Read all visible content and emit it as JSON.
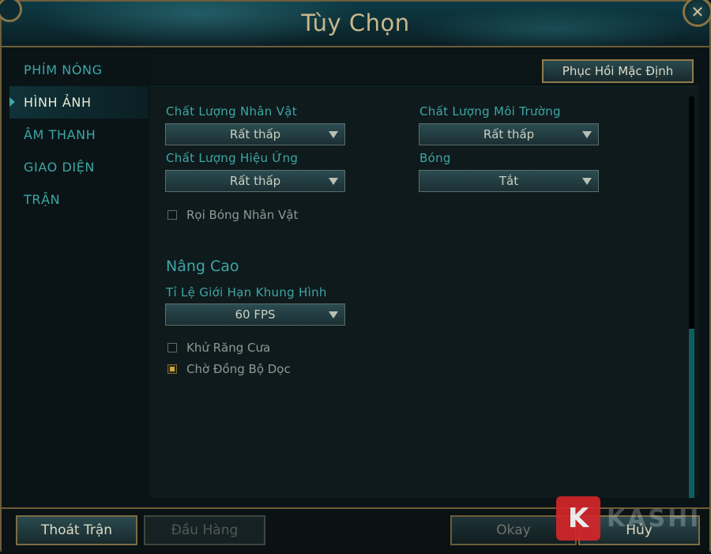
{
  "window": {
    "title": "Tùy Chọn",
    "close_icon": "close-icon"
  },
  "sidebar": {
    "items": [
      {
        "label": "PHÍM NÓNG",
        "active": false
      },
      {
        "label": "HÌNH ẢNH",
        "active": true
      },
      {
        "label": "ÂM THANH",
        "active": false
      },
      {
        "label": "GIAO DIỆN",
        "active": false
      },
      {
        "label": "TRẬN",
        "active": false
      }
    ]
  },
  "content": {
    "restore_button": "Phục Hồi Mặc Định",
    "character_quality": {
      "label": "Chất Lượng Nhân Vật",
      "value": "Rất thấp"
    },
    "environment_quality": {
      "label": "Chất Lượng Môi Trường",
      "value": "Rất thấp"
    },
    "effects_quality": {
      "label": "Chất Lượng Hiệu Ứng",
      "value": "Rất thấp"
    },
    "shadows": {
      "label": "Bóng",
      "value": "Tắt"
    },
    "character_shadows": {
      "label": "Rọi Bóng Nhân Vật",
      "checked": false
    },
    "advanced": {
      "title": "Nâng Cao",
      "frame_rate_cap": {
        "label": "Tỉ Lệ Giới Hạn Khung Hình",
        "value": "60 FPS"
      },
      "anti_aliasing": {
        "label": "Khử Răng Cưa",
        "checked": false
      },
      "vsync": {
        "label": "Chờ Đồng Bộ Dọc",
        "checked": true
      }
    }
  },
  "footer": {
    "exit_game": "Thoát Trận",
    "surrender": "Đầu Hàng",
    "okay": "Okay",
    "cancel": "Hủy"
  },
  "watermark": {
    "logo_letter": "K",
    "text": "KASHI"
  },
  "colors": {
    "accent_teal": "#3ea6a6",
    "gold_border": "#8f7c4d",
    "checked_gold": "#c9a545",
    "watermark_red": "#d7262a"
  }
}
